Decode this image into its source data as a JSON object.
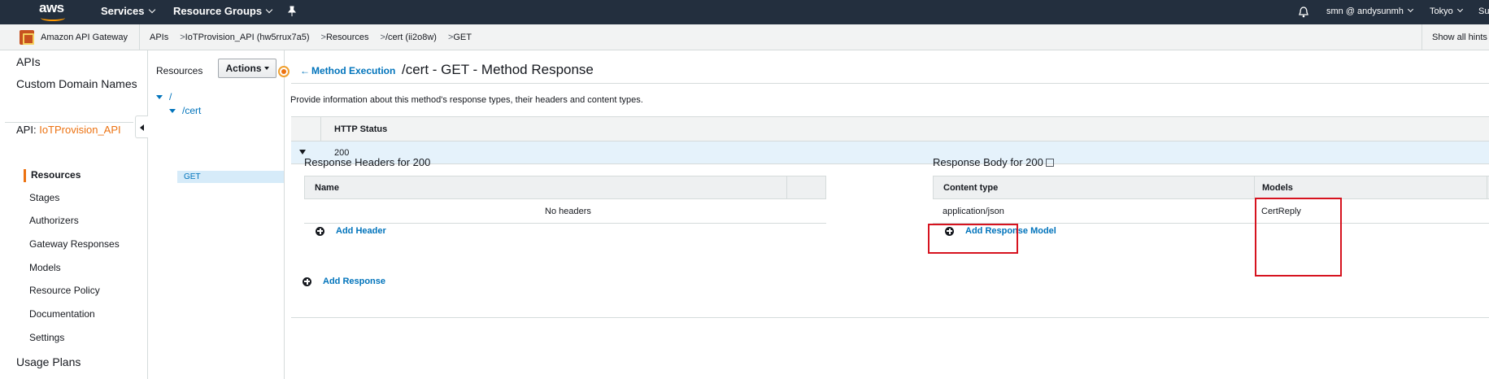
{
  "topnav": {
    "logo_text": "aws",
    "services_label": "Services",
    "resource_groups_label": "Resource Groups",
    "user_label": "smn @ andysunmh",
    "region_label": "Tokyo",
    "support_label": "Su"
  },
  "breadcrumb": {
    "service_name": "Amazon API Gateway",
    "items": [
      "APIs",
      "IoTProvision_API (hw5rrux7a5)",
      "Resources",
      "/cert (ii2o8w)",
      "GET"
    ],
    "separator": ">",
    "hints_label": "Show all hints"
  },
  "leftnav": {
    "apis": "APIs",
    "custom_domain": "Custom Domain Names",
    "api_prefix": "API:",
    "api_name": "IoTProvision_API",
    "items": [
      "Resources",
      "Stages",
      "Authorizers",
      "Gateway Responses",
      "Models",
      "Resource Policy",
      "Documentation",
      "Settings"
    ],
    "usage_plans": "Usage Plans"
  },
  "resources_panel": {
    "title": "Resources",
    "actions_label": "Actions",
    "tree": {
      "root": "/",
      "cert": "/cert",
      "method": "GET"
    }
  },
  "main": {
    "back_link": "Method Execution",
    "title": "/cert - GET - Method Response",
    "description": "Provide information about this method's response types, their headers and content types.",
    "status_header": "HTTP Status",
    "status_value": "200",
    "headers_section": {
      "title": "Response Headers for 200",
      "name_col": "Name",
      "empty_text": "No headers",
      "add_label": "Add Header"
    },
    "body_section": {
      "title": "Response Body for 200",
      "content_type_col": "Content type",
      "models_col": "Models",
      "content_type_value": "application/json",
      "model_value": "CertReply",
      "add_label": "Add Response Model"
    },
    "add_response_label": "Add Response"
  },
  "colors": {
    "nav_bg": "#232f3e",
    "accent": "#ec7211",
    "link": "#0073bb",
    "highlight": "#d6131f"
  }
}
